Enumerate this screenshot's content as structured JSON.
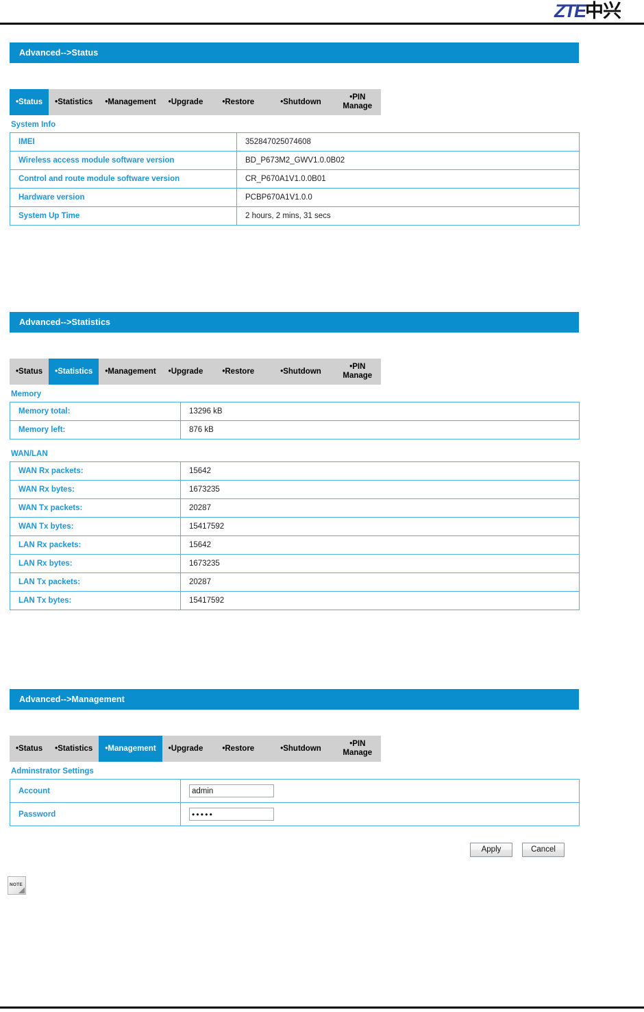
{
  "brand": {
    "logo_latin": "ZTE",
    "logo_cjk": "中兴"
  },
  "colors": {
    "accent_blue": "#0b8ecd",
    "label_blue": "#2196d6",
    "table_border": "#4eb3e4",
    "tab_inactive": "#d0d0d0",
    "logo_blue": "#2b3f9e"
  },
  "tabs": [
    {
      "label": "•Status"
    },
    {
      "label": "•Statistics"
    },
    {
      "label": "•Management"
    },
    {
      "label": "•Upgrade"
    },
    {
      "label": "•Restore"
    },
    {
      "label": "•Shutdown"
    },
    {
      "label": "•PIN Manage"
    }
  ],
  "sections": {
    "status": {
      "title": "Advanced-->Status",
      "active_tab": 0,
      "group_label": "System Info",
      "rows": [
        {
          "key": "IMEI",
          "value": "352847025074608"
        },
        {
          "key": "Wireless access module software version",
          "value": "BD_P673M2_GWV1.0.0B02"
        },
        {
          "key": "Control and route module software version",
          "value": "CR_P670A1V1.0.0B01"
        },
        {
          "key": "Hardware version",
          "value": "PCBP670A1V1.0.0"
        },
        {
          "key": "System Up Time",
          "value": "2 hours, 2 mins, 31 secs"
        }
      ]
    },
    "statistics": {
      "title": "Advanced-->Statistics",
      "active_tab": 1,
      "memory_label": "Memory",
      "memory_rows": [
        {
          "key": "Memory total:",
          "value": "13296 kB"
        },
        {
          "key": "Memory left:",
          "value": "876 kB"
        }
      ],
      "wanlan_label": "WAN/LAN",
      "wanlan_rows": [
        {
          "key": "WAN Rx packets:",
          "value": "15642"
        },
        {
          "key": "WAN Rx bytes:",
          "value": "1673235"
        },
        {
          "key": "WAN Tx packets:",
          "value": "20287"
        },
        {
          "key": "WAN Tx bytes:",
          "value": "15417592"
        },
        {
          "key": "LAN Rx packets:",
          "value": "15642"
        },
        {
          "key": "LAN Rx bytes:",
          "value": "1673235"
        },
        {
          "key": "LAN Tx packets:",
          "value": "20287"
        },
        {
          "key": "LAN Tx bytes:",
          "value": "15417592"
        }
      ]
    },
    "management": {
      "title": "Advanced-->Management",
      "active_tab": 2,
      "group_label": "Adminstrator Settings",
      "account_label": "Account",
      "account_value": "admin",
      "password_label": "Password",
      "password_value": "•••••",
      "apply_label": "Apply",
      "cancel_label": "Cancel",
      "note_icon_label": "NOTE"
    }
  }
}
